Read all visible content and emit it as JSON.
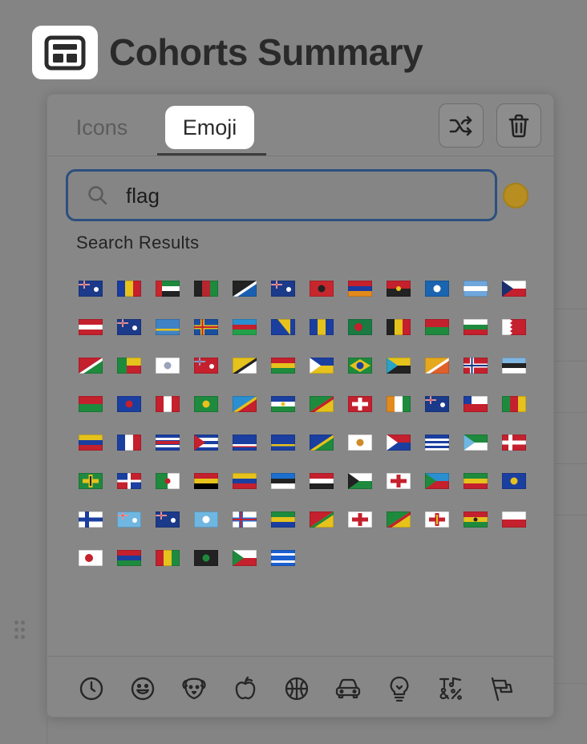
{
  "page": {
    "title": "Cohorts Summary",
    "icon": "dashboard-layout-icon"
  },
  "picker": {
    "tabs": [
      {
        "label": "Icons",
        "active": false
      },
      {
        "label": "Emoji",
        "active": true
      }
    ],
    "toolbar": {
      "shuffle_icon": "shuffle-icon",
      "remove_icon": "trash-icon"
    },
    "search": {
      "value": "flag",
      "icon": "search-icon"
    },
    "skin_tone_color": "#b78e1f",
    "section_label": "Search Results",
    "flags": [
      {
        "name": "flag-ascension",
        "colors": [
          "#1b3a8a",
          "#c0262d",
          "#ffffff"
        ],
        "style": "union"
      },
      {
        "name": "flag-andorra",
        "colors": [
          "#1a3ca0",
          "#e6c21c",
          "#c4202d"
        ],
        "style": "v3"
      },
      {
        "name": "flag-uae",
        "colors": [
          "#1d8a3c",
          "#ffffff",
          "#222222",
          "#c7262d"
        ],
        "style": "uae"
      },
      {
        "name": "flag-afghanistan",
        "colors": [
          "#222222",
          "#b5262e",
          "#1e8a3d"
        ],
        "style": "v3"
      },
      {
        "name": "flag-antigua",
        "colors": [
          "#222222",
          "#1b5fb0",
          "#ffffff",
          "#c4202d"
        ],
        "style": "diag"
      },
      {
        "name": "flag-anguilla",
        "colors": [
          "#1b3a8a",
          "#c0262d",
          "#ffffff"
        ],
        "style": "union"
      },
      {
        "name": "flag-albania",
        "colors": [
          "#c7262d",
          "#222222"
        ],
        "style": "solidemblem"
      },
      {
        "name": "flag-armenia",
        "colors": [
          "#c4202d",
          "#1a3ca0",
          "#e38a1c"
        ],
        "style": "h3"
      },
      {
        "name": "flag-angola",
        "colors": [
          "#c4202d",
          "#222222",
          "#e6c21c"
        ],
        "style": "h2emblem"
      },
      {
        "name": "flag-antarctica",
        "colors": [
          "#1a64b0",
          "#ffffff"
        ],
        "style": "solidemblem"
      },
      {
        "name": "flag-argentina",
        "colors": [
          "#6fa7dc",
          "#ffffff",
          "#6fa7dc"
        ],
        "style": "h3"
      },
      {
        "name": "flag-american-samoa",
        "colors": [
          "#1b2f70",
          "#ffffff",
          "#c4202d"
        ],
        "style": "tri"
      },
      {
        "name": "flag-austria",
        "colors": [
          "#c4202d",
          "#ffffff",
          "#c4202d"
        ],
        "style": "h3"
      },
      {
        "name": "flag-australia",
        "colors": [
          "#1b3a8a",
          "#c0262d",
          "#ffffff"
        ],
        "style": "union"
      },
      {
        "name": "flag-aruba",
        "colors": [
          "#3f82c6",
          "#e6c21c"
        ],
        "style": "solidstripe"
      },
      {
        "name": "flag-aland",
        "colors": [
          "#1a4ea0",
          "#e6c21c",
          "#c4202d"
        ],
        "style": "nordic"
      },
      {
        "name": "flag-azerbaijan",
        "colors": [
          "#2a8fd0",
          "#c4202d",
          "#22a04a"
        ],
        "style": "h3"
      },
      {
        "name": "flag-bosnia",
        "colors": [
          "#1b3fa0",
          "#e6c21c"
        ],
        "style": "diagtri"
      },
      {
        "name": "flag-barbados",
        "colors": [
          "#1b3fa0",
          "#e6c21c",
          "#1b3fa0"
        ],
        "style": "v3"
      },
      {
        "name": "flag-bangladesh",
        "colors": [
          "#1a7a42",
          "#c4202d"
        ],
        "style": "disc"
      },
      {
        "name": "flag-belgium",
        "colors": [
          "#222222",
          "#e6c21c",
          "#c4202d"
        ],
        "style": "v3"
      },
      {
        "name": "flag-burkina-faso",
        "colors": [
          "#c4202d",
          "#1e8a3d"
        ],
        "style": "h2emblem"
      },
      {
        "name": "flag-bulgaria",
        "colors": [
          "#ffffff",
          "#1e8a3d",
          "#c4202d"
        ],
        "style": "h3"
      },
      {
        "name": "flag-bahrain",
        "colors": [
          "#ffffff",
          "#c4202d"
        ],
        "style": "serrated"
      },
      {
        "name": "flag-burundi",
        "colors": [
          "#c4202d",
          "#1e8a3d",
          "#ffffff"
        ],
        "style": "diag"
      },
      {
        "name": "flag-benin",
        "colors": [
          "#1e8a3d",
          "#e6c21c",
          "#c4202d"
        ],
        "style": "benin"
      },
      {
        "name": "flag-st-barthelemy",
        "colors": [
          "#ffffff",
          "#9aa3b8"
        ],
        "style": "solidemblem"
      },
      {
        "name": "flag-bermuda",
        "colors": [
          "#c4202d",
          "#1b3a8a",
          "#ffffff"
        ],
        "style": "union"
      },
      {
        "name": "flag-brunei",
        "colors": [
          "#e6c21c",
          "#ffffff",
          "#222222"
        ],
        "style": "diag"
      },
      {
        "name": "flag-bolivia",
        "colors": [
          "#c4202d",
          "#e6c21c",
          "#1e8a3d"
        ],
        "style": "h3"
      },
      {
        "name": "flag-caribbean-netherlands",
        "colors": [
          "#ffffff",
          "#1b3fa0",
          "#e6c21c"
        ],
        "style": "tri"
      },
      {
        "name": "flag-brazil",
        "colors": [
          "#1e8a3d",
          "#e6c21c",
          "#1b3fa0"
        ],
        "style": "brazil"
      },
      {
        "name": "flag-bahamas",
        "colors": [
          "#2aa3c4",
          "#e6c21c",
          "#222222"
        ],
        "style": "tri"
      },
      {
        "name": "flag-bhutan",
        "colors": [
          "#e6a81c",
          "#e0602a",
          "#ffffff"
        ],
        "style": "diag"
      },
      {
        "name": "flag-bouvet",
        "colors": [
          "#c4202d",
          "#ffffff",
          "#1b3a8a"
        ],
        "style": "nordic"
      },
      {
        "name": "flag-botswana",
        "colors": [
          "#7fb6e0",
          "#222222",
          "#ffffff"
        ],
        "style": "h3"
      },
      {
        "name": "flag-belarus",
        "colors": [
          "#c4202d",
          "#1e8a3d"
        ],
        "style": "h2emblem"
      },
      {
        "name": "flag-belize",
        "colors": [
          "#1b3fa0",
          "#c4202d",
          "#ffffff"
        ],
        "style": "solidemblem"
      },
      {
        "name": "flag-canada",
        "colors": [
          "#c4202d",
          "#ffffff",
          "#c4202d"
        ],
        "style": "v3"
      },
      {
        "name": "flag-cocos",
        "colors": [
          "#1e8a3d",
          "#e6c21c"
        ],
        "style": "solidemblem"
      },
      {
        "name": "flag-congo-kinshasa",
        "colors": [
          "#2a8fd0",
          "#c4202d",
          "#e6c21c"
        ],
        "style": "diag"
      },
      {
        "name": "flag-central-african-republic",
        "colors": [
          "#1b3fa0",
          "#ffffff",
          "#1e8a3d",
          "#e6c21c"
        ],
        "style": "h3"
      },
      {
        "name": "flag-congo-brazzaville",
        "colors": [
          "#1e8a3d",
          "#e6c21c",
          "#c4202d"
        ],
        "style": "diag"
      },
      {
        "name": "flag-switzerland",
        "colors": [
          "#c4202d",
          "#ffffff"
        ],
        "style": "cross"
      },
      {
        "name": "flag-cote-divoire",
        "colors": [
          "#e38a1c",
          "#ffffff",
          "#1e8a3d"
        ],
        "style": "v3"
      },
      {
        "name": "flag-cook-islands",
        "colors": [
          "#1b3a8a",
          "#c0262d",
          "#ffffff"
        ],
        "style": "union"
      },
      {
        "name": "flag-chile",
        "colors": [
          "#ffffff",
          "#c4202d",
          "#1b3fa0"
        ],
        "style": "chile"
      },
      {
        "name": "flag-cameroon",
        "colors": [
          "#1e8a3d",
          "#c4202d",
          "#e6c21c"
        ],
        "style": "v3"
      },
      {
        "name": "flag-colombia",
        "colors": [
          "#e6c21c",
          "#1b3fa0",
          "#c4202d"
        ],
        "style": "h3"
      },
      {
        "name": "flag-france",
        "colors": [
          "#1b3fa0",
          "#ffffff",
          "#c4202d"
        ],
        "style": "v3"
      },
      {
        "name": "flag-costa-rica",
        "colors": [
          "#1b3fa0",
          "#ffffff",
          "#c4202d"
        ],
        "style": "h5"
      },
      {
        "name": "flag-cuba",
        "colors": [
          "#1b3fa0",
          "#ffffff",
          "#c4202d"
        ],
        "style": "tristripes"
      },
      {
        "name": "flag-cape-verde",
        "colors": [
          "#1b3fa0",
          "#ffffff",
          "#c4202d"
        ],
        "style": "solidstripe"
      },
      {
        "name": "flag-curacao",
        "colors": [
          "#1b3fa0",
          "#e6c21c"
        ],
        "style": "solidstripe"
      },
      {
        "name": "flag-christmas-island",
        "colors": [
          "#1b3fa0",
          "#1e8a3d",
          "#e6c21c"
        ],
        "style": "diag"
      },
      {
        "name": "flag-cyprus",
        "colors": [
          "#ffffff",
          "#d08a2a"
        ],
        "style": "solidemblem"
      },
      {
        "name": "flag-czechia",
        "colors": [
          "#ffffff",
          "#c4202d",
          "#1b3fa0"
        ],
        "style": "tri"
      },
      {
        "name": "flag-germany-wave",
        "colors": [
          "#1b3fa0",
          "#ffffff",
          "#c4202d"
        ],
        "style": "wavy"
      },
      {
        "name": "flag-djibouti",
        "colors": [
          "#6fb6e0",
          "#1e8a3d",
          "#ffffff"
        ],
        "style": "tri"
      },
      {
        "name": "flag-denmark",
        "colors": [
          "#c4202d",
          "#ffffff"
        ],
        "style": "nordic"
      },
      {
        "name": "flag-dominica",
        "colors": [
          "#1e8a3d",
          "#e6c21c",
          "#222222"
        ],
        "style": "cross"
      },
      {
        "name": "flag-dominican-republic",
        "colors": [
          "#1b3fa0",
          "#c4202d",
          "#ffffff"
        ],
        "style": "quad"
      },
      {
        "name": "flag-algeria",
        "colors": [
          "#1e8a3d",
          "#ffffff",
          "#c4202d"
        ],
        "style": "v2emblem"
      },
      {
        "name": "flag-ceuta",
        "colors": [
          "#c4202d",
          "#e6c21c"
        ],
        "style": "h3"
      },
      {
        "name": "flag-ecuador",
        "colors": [
          "#e6c21c",
          "#1b3fa0",
          "#c4202d"
        ],
        "style": "h3"
      },
      {
        "name": "flag-estonia",
        "colors": [
          "#1b6fd0",
          "#222222",
          "#ffffff"
        ],
        "style": "h3"
      },
      {
        "name": "flag-egypt",
        "colors": [
          "#c4202d",
          "#ffffff",
          "#222222"
        ],
        "style": "h3"
      },
      {
        "name": "flag-western-sahara",
        "colors": [
          "#222222",
          "#ffffff",
          "#1e8a3d",
          "#c4202d"
        ],
        "style": "tri"
      },
      {
        "name": "flag-england",
        "colors": [
          "#ffffff",
          "#c4202d"
        ],
        "style": "cross"
      },
      {
        "name": "flag-eritrea",
        "colors": [
          "#1e8a3d",
          "#2a8fd0",
          "#c4202d"
        ],
        "style": "tri"
      },
      {
        "name": "flag-ethiopia",
        "colors": [
          "#1e8a3d",
          "#e6c21c",
          "#c4202d"
        ],
        "style": "h3"
      },
      {
        "name": "flag-eu",
        "colors": [
          "#1b3fa0",
          "#e6c21c"
        ],
        "style": "solidemblem"
      },
      {
        "name": "flag-finland",
        "colors": [
          "#ffffff",
          "#1b3fa0"
        ],
        "style": "nordic"
      },
      {
        "name": "flag-fiji",
        "colors": [
          "#6fb6e0",
          "#c0262d",
          "#ffffff"
        ],
        "style": "union"
      },
      {
        "name": "flag-falkland",
        "colors": [
          "#1b3a8a",
          "#c0262d",
          "#ffffff"
        ],
        "style": "union"
      },
      {
        "name": "flag-micronesia",
        "colors": [
          "#6fb6e0",
          "#ffffff"
        ],
        "style": "solidemblem"
      },
      {
        "name": "flag-faroe",
        "colors": [
          "#ffffff",
          "#2a6fd0",
          "#c4202d"
        ],
        "style": "nordic"
      },
      {
        "name": "flag-gabon",
        "colors": [
          "#1e8a3d",
          "#e6c21c",
          "#1b3fa0"
        ],
        "style": "h3"
      },
      {
        "name": "flag-grenada",
        "colors": [
          "#c4202d",
          "#e6c21c",
          "#1e8a3d"
        ],
        "style": "diag"
      },
      {
        "name": "flag-georgia",
        "colors": [
          "#ffffff",
          "#c4202d"
        ],
        "style": "cross"
      },
      {
        "name": "flag-french-guiana",
        "colors": [
          "#1e8a3d",
          "#e6c21c",
          "#c4202d"
        ],
        "style": "diag"
      },
      {
        "name": "flag-guernsey",
        "colors": [
          "#ffffff",
          "#c4202d",
          "#e6c21c"
        ],
        "style": "cross"
      },
      {
        "name": "flag-ghana",
        "colors": [
          "#c4202d",
          "#e6c21c",
          "#1e8a3d",
          "#222222"
        ],
        "style": "h3"
      },
      {
        "name": "flag-gibraltar",
        "colors": [
          "#ffffff",
          "#c4202d"
        ],
        "style": "h2emblem"
      },
      {
        "name": "flag-greenland",
        "colors": [
          "#ffffff",
          "#c4202d"
        ],
        "style": "disc"
      },
      {
        "name": "flag-gambia",
        "colors": [
          "#c4202d",
          "#1b3fa0",
          "#1e8a3d"
        ],
        "style": "h3"
      },
      {
        "name": "flag-guinea",
        "colors": [
          "#c4202d",
          "#e6c21c",
          "#1e8a3d"
        ],
        "style": "v3"
      },
      {
        "name": "flag-guadeloupe",
        "colors": [
          "#222222",
          "#1e8a3d",
          "#e6c21c"
        ],
        "style": "solidemblem"
      },
      {
        "name": "flag-equatorial-guinea",
        "colors": [
          "#1e8a3d",
          "#ffffff",
          "#c4202d",
          "#1b3fa0"
        ],
        "style": "tri"
      },
      {
        "name": "flag-greece",
        "colors": [
          "#1b5fd0",
          "#ffffff"
        ],
        "style": "h5"
      }
    ],
    "categories": [
      {
        "name": "category-recent-icon"
      },
      {
        "name": "category-smileys-icon"
      },
      {
        "name": "category-animals-icon"
      },
      {
        "name": "category-food-icon"
      },
      {
        "name": "category-activity-icon"
      },
      {
        "name": "category-travel-icon"
      },
      {
        "name": "category-objects-icon"
      },
      {
        "name": "category-symbols-icon"
      },
      {
        "name": "category-flags-icon"
      }
    ]
  }
}
